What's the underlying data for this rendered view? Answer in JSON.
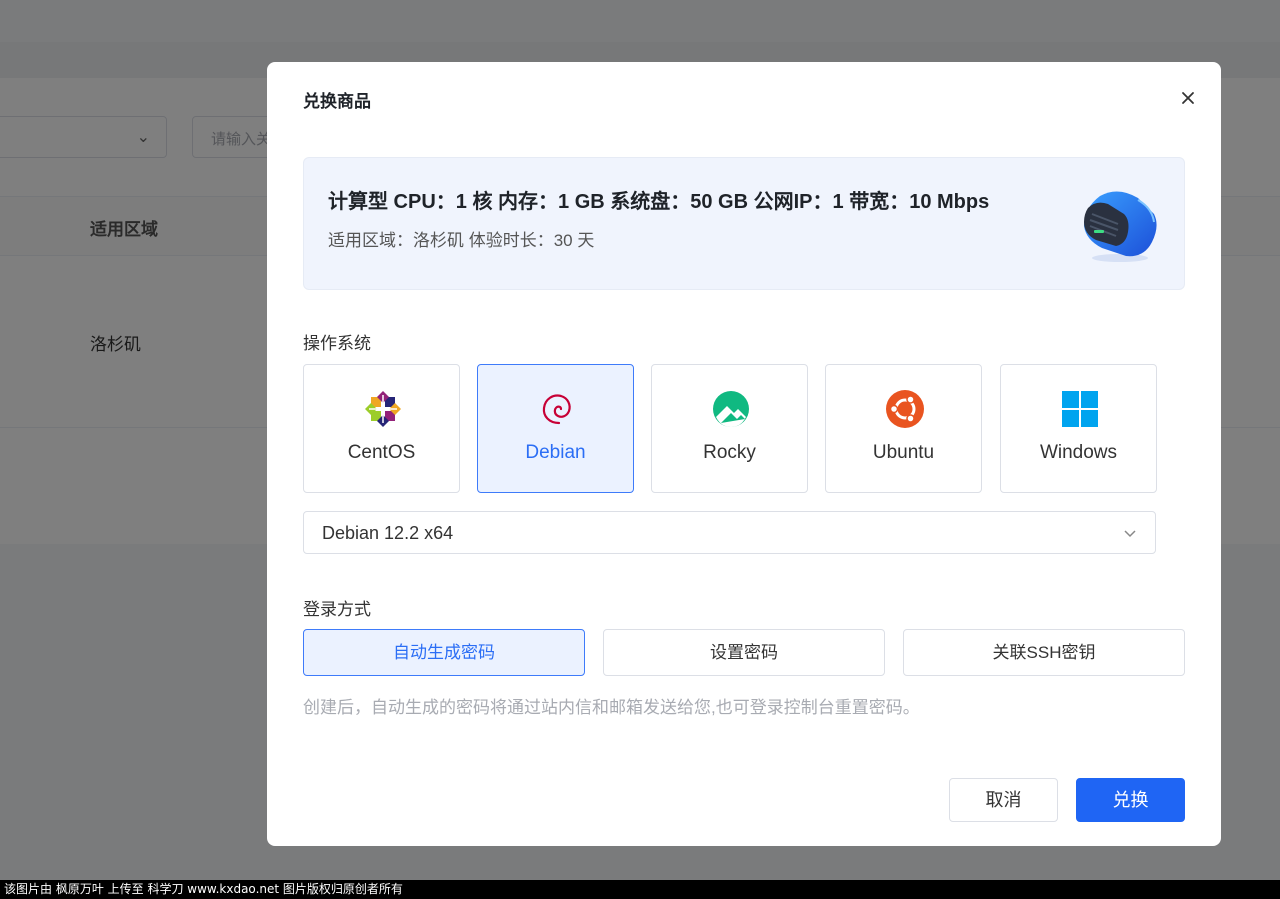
{
  "background": {
    "filter_placeholder": "请输入关键字",
    "table_header": "适用区域",
    "table_cell": "洛杉矶"
  },
  "dialog": {
    "title": "兑换商品",
    "product": {
      "spec": "计算型 CPU：1 核 内存：1 GB 系统盘：50 GB 公网IP：1 带宽：10 Mbps",
      "sub": "适用区域：洛杉矶 体验时长：30 天"
    },
    "os_section": {
      "label": "操作系统",
      "options": [
        {
          "name": "CentOS",
          "icon": "centos-icon",
          "selected": false
        },
        {
          "name": "Debian",
          "icon": "debian-icon",
          "selected": true
        },
        {
          "name": "Rocky",
          "icon": "rocky-icon",
          "selected": false
        },
        {
          "name": "Ubuntu",
          "icon": "ubuntu-icon",
          "selected": false
        },
        {
          "name": "Windows",
          "icon": "windows-icon",
          "selected": false
        }
      ],
      "version": "Debian 12.2 x64"
    },
    "login_section": {
      "label": "登录方式",
      "options": [
        {
          "label": "自动生成密码",
          "selected": true
        },
        {
          "label": "设置密码",
          "selected": false
        },
        {
          "label": "关联SSH密钥",
          "selected": false
        }
      ],
      "hint": "创建后，自动生成的密码将通过站内信和邮箱发送给您,也可登录控制台重置密码。"
    },
    "footer": {
      "cancel": "取消",
      "confirm": "兑换"
    }
  },
  "colors": {
    "primary": "#1f65f4",
    "selected_bg": "#ebf2ff",
    "selected_border": "#3e7bfa"
  },
  "watermark": "该图片由 枫原万叶 上传至 科学刀 www.kxdao.net 图片版权归原创者所有"
}
